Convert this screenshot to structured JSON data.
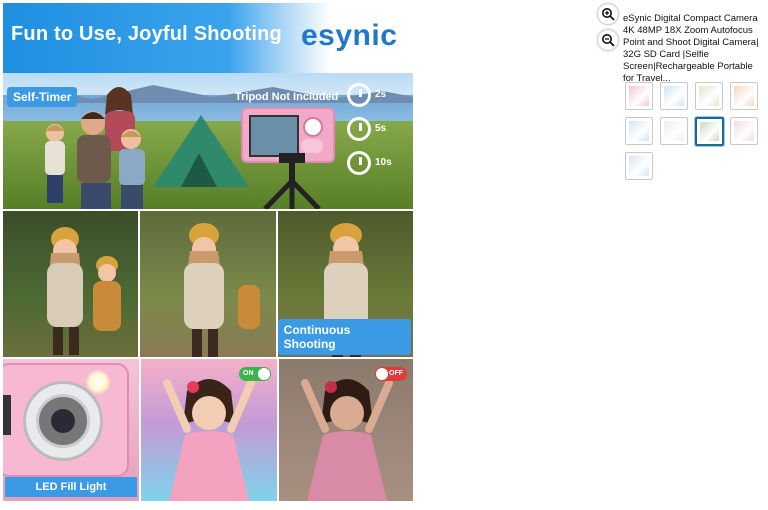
{
  "main_image": {
    "banner_text": "Fun to Use, Joyful Shooting",
    "brand": "esynic",
    "self_timer_label": "Self-Timer",
    "tripod_note": "Tripod Not Included",
    "timer_options": [
      "2s",
      "5s",
      "10s"
    ],
    "continuous_label": "Continuous Shooting",
    "led_label": "LED Fill Light",
    "toggle_on_label": "ON",
    "toggle_off_label": "OFF"
  },
  "product": {
    "title": "eSynic Digital Compact Camera 4K 48MP 18X Zoom Autofocus Point and Shoot Digital Camera| 32G SD Card |Selfie Screen|Rechargeable Portable for Travel..."
  },
  "zoom": {
    "in_icon": "zoom-in-icon",
    "out_icon": "zoom-out-icon"
  },
  "thumbnails": {
    "count": 9,
    "active_index": 6,
    "colors": [
      "#f1c4d8",
      "#cfe3f2",
      "#dfe9c7",
      "#f3d8c0",
      "#cfe6f5",
      "#e9eef3",
      "#c9d8c0",
      "#f2d9e6",
      "#d6e6f2"
    ]
  },
  "colors": {
    "accent_blue": "#3a9ae6",
    "brand_blue": "#1f78c8",
    "active_border": "#1d6a8e"
  }
}
